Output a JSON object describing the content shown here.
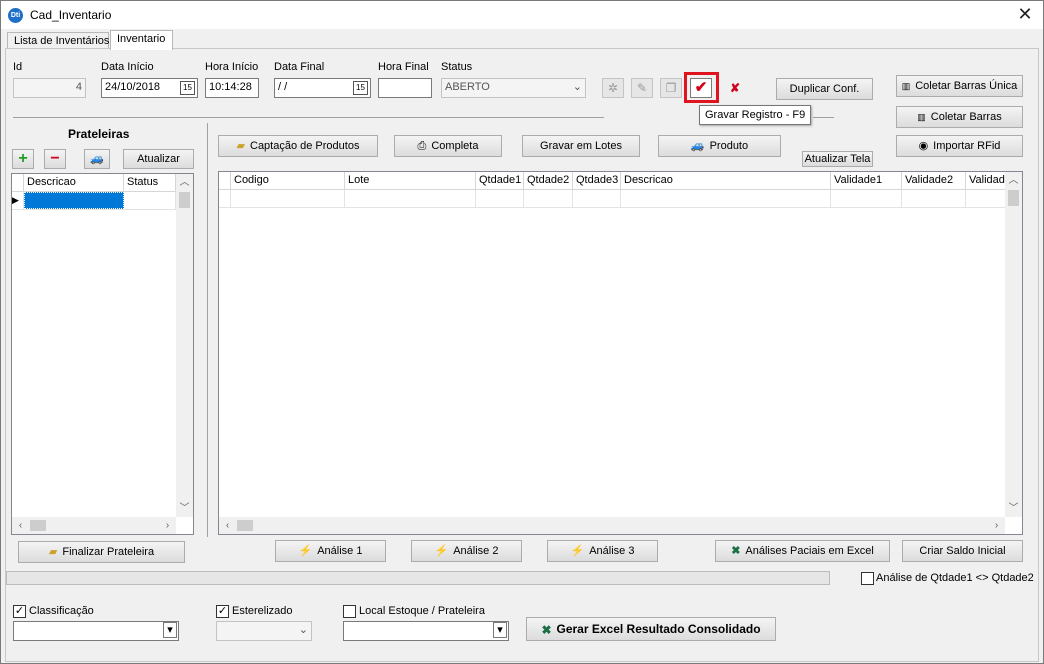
{
  "window": {
    "title": "Cad_Inventario",
    "icon_text": "Dti"
  },
  "tabs": [
    {
      "label": "Lista de Inventários"
    },
    {
      "label": "Inventario"
    }
  ],
  "form": {
    "id_label": "Id",
    "id_value": "4",
    "data_inicio_label": "Data Início",
    "data_inicio_value": "24/10/2018",
    "hora_inicio_label": "Hora Início",
    "hora_inicio_value": "10:14:28",
    "data_final_label": "Data Final",
    "data_final_value": " / /",
    "hora_final_label": "Hora Final",
    "hora_final_value": "",
    "status_label": "Status",
    "status_value": "ABERTO",
    "calendar_glyph": "15"
  },
  "toolbar": {
    "save_tooltip": "Gravar Registro - F9",
    "duplicar_label": "Duplicar Conf."
  },
  "side_buttons": {
    "coletar_unica": "Coletar Barras Única",
    "coletar_barras": "Coletar Barras",
    "importar_rfid": "Importar RFid"
  },
  "prateleiras": {
    "title": "Prateleiras",
    "atualizar_label": "Atualizar",
    "columns": [
      "Descricao",
      "Status"
    ],
    "finalizar_label": "Finalizar Prateleira"
  },
  "actions": {
    "captacao": "Captação de Produtos",
    "completa": "Completa",
    "gravar_lotes": "Gravar em Lotes",
    "produto": "Produto",
    "atualizar_tela": "Atualizar Tela"
  },
  "produtos_grid": {
    "columns": [
      "Codigo",
      "Lote",
      "Qtdade1",
      "Qtdade2",
      "Qtdade3",
      "Descricao",
      "Validade1",
      "Validade2",
      "Validad"
    ]
  },
  "analysis": {
    "analise1": "Análise 1",
    "analise2": "Análise 2",
    "analise3": "Análise 3",
    "analises_excel": "Análises Paciais em Excel",
    "criar_saldo": "Criar Saldo Inicial",
    "qtdade_check_label": "Análise de Qtdade1 <> Qtdade2"
  },
  "bottom": {
    "classificacao_label": "Classificação",
    "esterelizado_label": "Esterelizado",
    "local_estoque_label": "Local Estoque / Prateleira",
    "gerar_excel_label": "Gerar Excel Resultado Consolidado"
  },
  "colors": {
    "highlight": "#e0141e",
    "selection": "#0078d7",
    "check_red": "#d0021b"
  }
}
